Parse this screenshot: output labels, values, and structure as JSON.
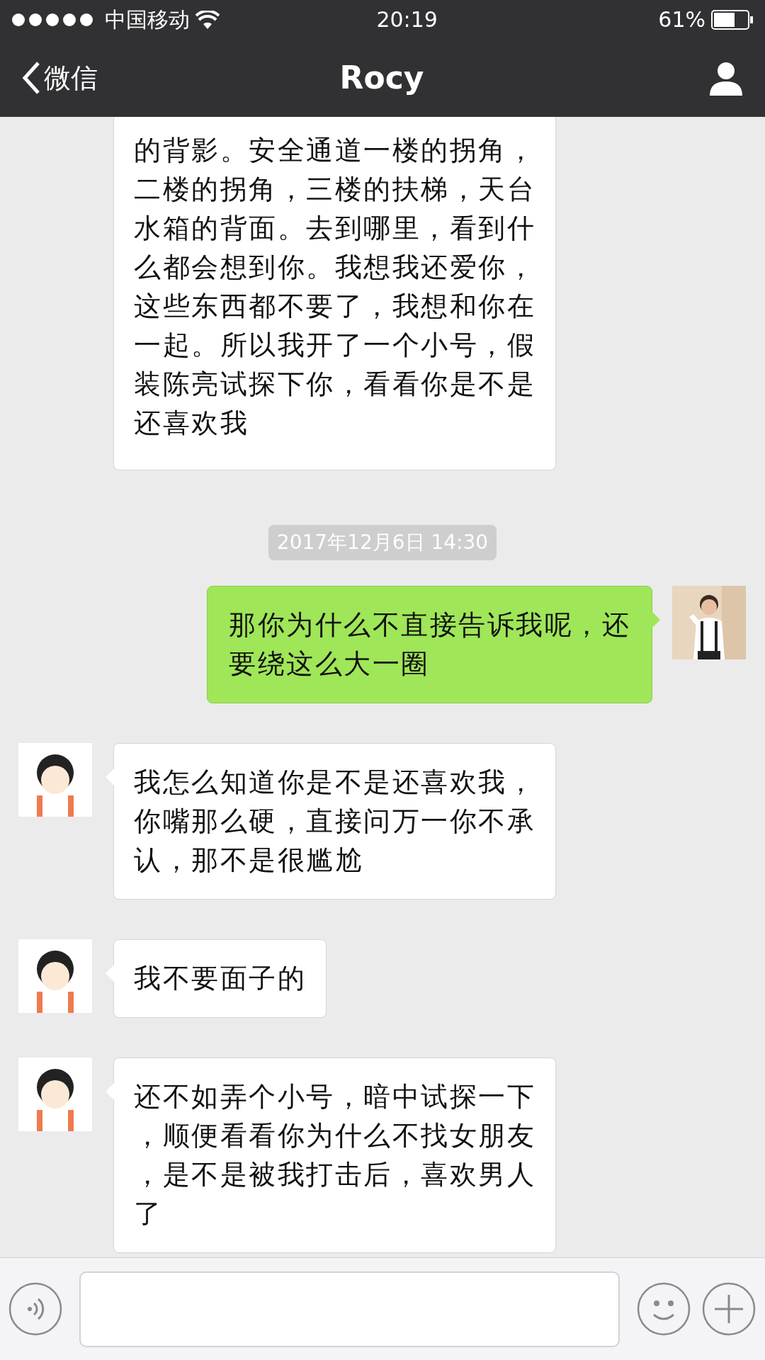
{
  "status_bar": {
    "carrier": "中国移动",
    "time": "20:19",
    "battery": "61%"
  },
  "nav": {
    "back": "微信",
    "title": "Rocy"
  },
  "messages": [
    {
      "kind": "incoming",
      "lines": [
        "的背影。安全通道一楼的拐角，",
        "二楼的拐角，三楼的扶梯，天台",
        "水箱的背面。去到哪里，看到什",
        "么都会想到你。我想我还爱你，",
        "这些东西都不要了，我想和你在",
        "一起。所以我开了一个小号，假",
        "装陈亮试探下你，看看你是不是",
        "还喜欢我"
      ]
    },
    {
      "kind": "timestamp",
      "text": "2017年12月6日 14:30"
    },
    {
      "kind": "outgoing",
      "lines": [
        "那你为什么不直接告诉我呢，还",
        "要绕这么大一圈"
      ]
    },
    {
      "kind": "incoming",
      "lines": [
        "我怎么知道你是不是还喜欢我，",
        "你嘴那么硬，直接问万一你不承",
        "认，那不是很尴尬"
      ]
    },
    {
      "kind": "incoming",
      "lines": [
        "我不要面子的"
      ]
    },
    {
      "kind": "incoming",
      "lines": [
        "还不如弄个小号，暗中试探一下",
        "，顺便看看你为什么不找女朋友",
        "，是不是被我打击后，喜欢男人",
        "了"
      ]
    }
  ]
}
